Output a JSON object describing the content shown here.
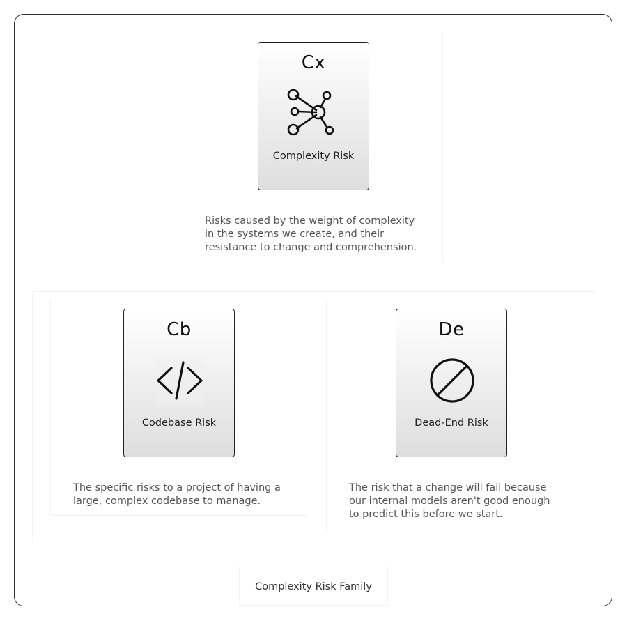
{
  "diagram": {
    "caption": "Complexity Risk Family",
    "top": {
      "abbr": "Cx",
      "name": "Complexity Risk",
      "icon": "network-graph-icon",
      "description": [
        "Risks caused by the weight of complexity",
        "in the systems we create, and their",
        "resistance to change and comprehension."
      ]
    },
    "left": {
      "abbr": "Cb",
      "name": "Codebase Risk",
      "icon": "code-brackets-icon",
      "description": [
        "The specific risks to a project of having a",
        "large, complex codebase to manage."
      ]
    },
    "right": {
      "abbr": "De",
      "name": "Dead-End Risk",
      "icon": "prohibited-icon",
      "description": [
        "The risk that a change will fail because",
        "our internal models aren't good enough",
        "to predict this before we start."
      ]
    }
  }
}
